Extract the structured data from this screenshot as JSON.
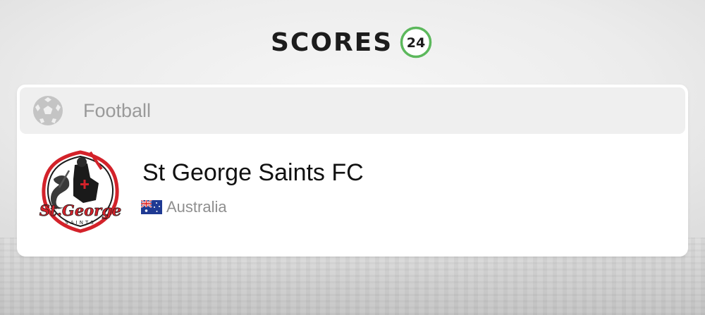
{
  "brand": {
    "name": "SCORES",
    "badge_number": "24",
    "badge_color": "#5cb85c"
  },
  "sport": {
    "label": "Football",
    "icon": "football-icon"
  },
  "team": {
    "name": "St George Saints FC",
    "crest_text": "St.George",
    "crest_subtext": "SAINTS",
    "country": "Australia",
    "country_flag": "australia-flag-icon"
  },
  "colors": {
    "card_background": "#ffffff",
    "header_background": "#efefef",
    "crest_red": "#d3222a"
  }
}
